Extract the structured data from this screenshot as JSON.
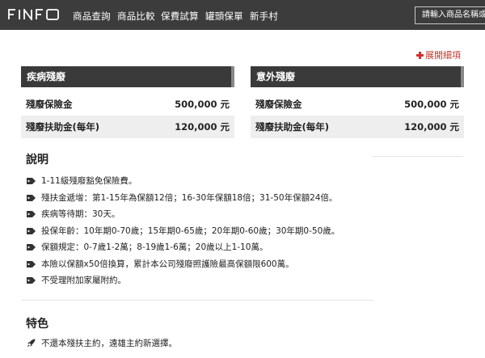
{
  "nav": {
    "logo": "FINFO",
    "items": [
      "商品查詢",
      "商品比較",
      "保費試算",
      "罐頭保單",
      "新手村"
    ],
    "search_placeholder": "請輸入商品名稱或"
  },
  "expand_label": "展開細項",
  "tables": [
    {
      "title": "疾病殘廢",
      "rows": [
        {
          "label": "殘廢保險金",
          "value": "500,000 元"
        },
        {
          "label": "殘廢扶助金(每年)",
          "value": "120,000 元"
        }
      ]
    },
    {
      "title": "意外殘廢",
      "rows": [
        {
          "label": "殘廢保險金",
          "value": "500,000 元"
        },
        {
          "label": "殘廢扶助金(每年)",
          "value": "120,000 元"
        }
      ]
    }
  ],
  "notes": {
    "title": "說明",
    "items": [
      "1-11級殘廢豁免保險費。",
      "殘扶金遞增：第1-15年為保額12倍；16-30年保額18倍；31-50年保額24倍。",
      "疾病等待期：30天。",
      "投保年齡：10年期0-70歲；15年期0-65歲；20年期0-60歲；30年期0-50歲。",
      "保額規定：0-7歲1-2萬；8-19歲1-6萬；20歲以上1-10萬。",
      "本險以保額x50倍換算，累計本公司殘廢照護險最高保額限600萬。",
      "不受理附加家屬附約。"
    ]
  },
  "features": {
    "title": "特色",
    "items": [
      "不還本殘扶主約，遠雄主約新選擇。"
    ]
  },
  "colors": {
    "nav_bg": "#3c3c3c",
    "table_header_bg": "#3a3a3a",
    "accent_red": "#d32f2f"
  }
}
